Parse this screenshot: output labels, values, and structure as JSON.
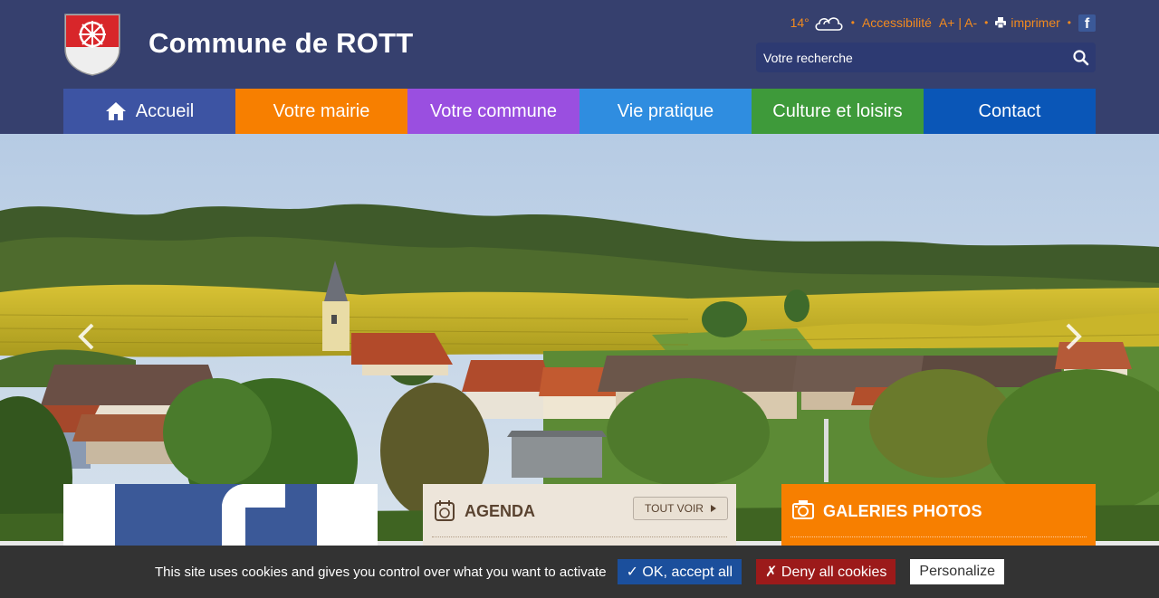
{
  "header": {
    "site_title": "Commune de ROTT",
    "weather": {
      "temperature": "14°",
      "icon": "cloud-icon"
    },
    "accessibility_label": "Accessibilité",
    "font_size_controls": "A+ | A-",
    "print_label": "imprimer",
    "social_icon": "facebook-icon",
    "search": {
      "placeholder": "Votre recherche"
    },
    "accent_color": "#f28a1e",
    "background_color": "#36406e"
  },
  "nav": {
    "items": [
      {
        "label": "Accueil",
        "color": "#3d54a3",
        "icon": "home-icon"
      },
      {
        "label": "Votre mairie",
        "color": "#f77f00"
      },
      {
        "label": "Votre commune",
        "color": "#9a4fe0"
      },
      {
        "label": "Vie pratique",
        "color": "#2f8de0"
      },
      {
        "label": "Culture et loisirs",
        "color": "#3e9a3a"
      },
      {
        "label": "Contact",
        "color": "#0a56b7"
      }
    ]
  },
  "hero": {
    "prev_icon": "chevron-left-icon",
    "next_icon": "chevron-right-icon"
  },
  "cards": {
    "agenda": {
      "title": "AGENDA",
      "see_all": "TOUT VOIR",
      "color": "#ede5da"
    },
    "galleries": {
      "title": "GALERIES PHOTOS",
      "color": "#f77f00"
    }
  },
  "cookie_bar": {
    "message": "This site uses cookies and gives you control over what you want to activate",
    "accept_label": "✓ OK, accept all",
    "deny_label": "✗ Deny all cookies",
    "personalize_label": "Personalize"
  }
}
